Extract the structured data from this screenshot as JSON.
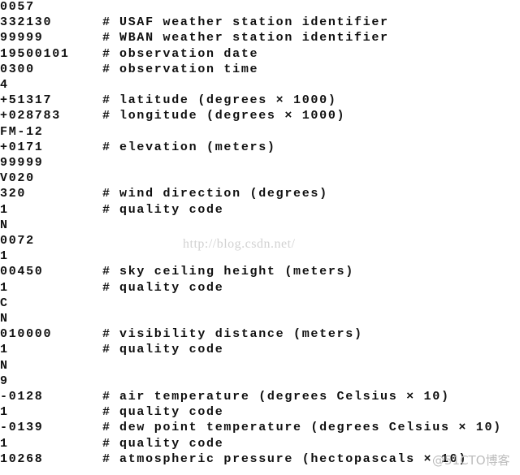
{
  "lines": [
    [
      "0057",
      ""
    ],
    [
      "332130",
      "USAF weather station identifier"
    ],
    [
      "99999",
      "WBAN weather station identifier"
    ],
    [
      "19500101",
      "observation date"
    ],
    [
      "0300",
      "observation time"
    ],
    [
      "4",
      ""
    ],
    [
      "+51317",
      "latitude (degrees × 1000)"
    ],
    [
      "+028783",
      "longitude (degrees × 1000)"
    ],
    [
      "FM-12",
      ""
    ],
    [
      "+0171",
      "elevation (meters)"
    ],
    [
      "99999",
      ""
    ],
    [
      "V020",
      ""
    ],
    [
      "320",
      "wind direction (degrees)"
    ],
    [
      "1",
      "quality code"
    ],
    [
      "N",
      ""
    ],
    [
      "0072",
      ""
    ],
    [
      "1",
      ""
    ],
    [
      "00450",
      "sky ceiling height (meters)"
    ],
    [
      "1",
      "quality code"
    ],
    [
      "C",
      ""
    ],
    [
      "N",
      ""
    ],
    [
      "010000",
      "visibility distance (meters)"
    ],
    [
      "1",
      "quality code"
    ],
    [
      "N",
      ""
    ],
    [
      "9",
      ""
    ],
    [
      "-0128",
      "air temperature (degrees Celsius × 10)"
    ],
    [
      "1",
      "quality code"
    ],
    [
      "-0139",
      "dew point temperature (degrees Celsius × 10)"
    ],
    [
      "1",
      "quality code"
    ],
    [
      "10268",
      "atmospheric pressure (hectopascals × 10)"
    ]
  ],
  "comment_marker": "#",
  "watermark_url": "http://blog.csdn.net/",
  "watermark_logo": "@51CTO博客"
}
